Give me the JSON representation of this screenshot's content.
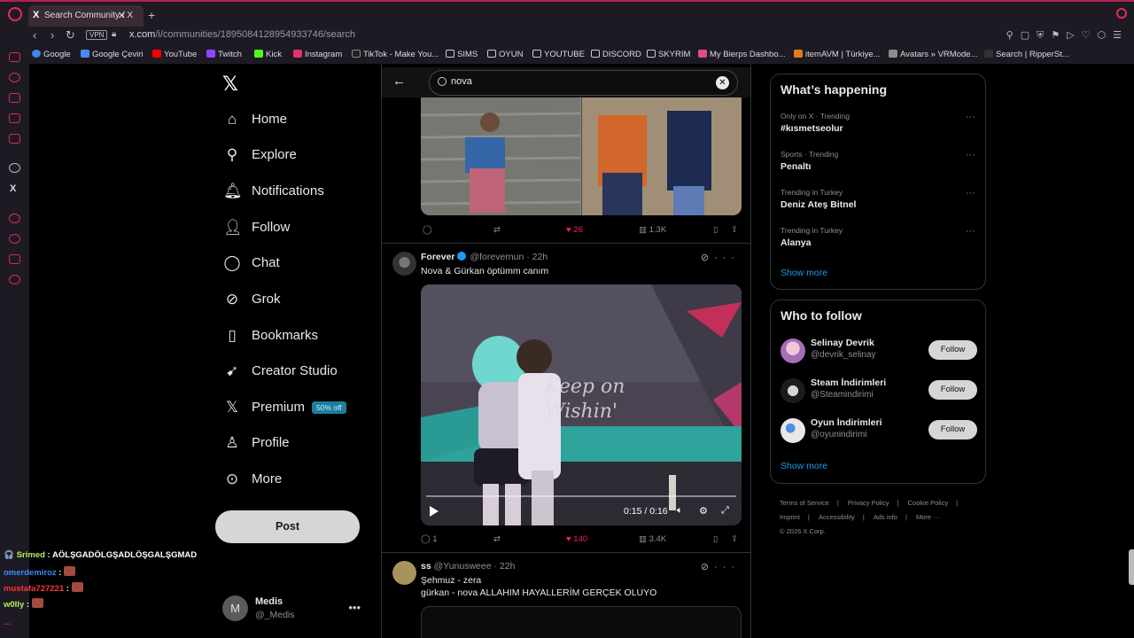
{
  "browser": {
    "tab_title": "Search Community / X",
    "tab_close": "✕",
    "new_tab": "+",
    "vpn_label": "VPN",
    "url_host": "x.com",
    "url_path": "/i/communities/1895084128954933746/search",
    "bookmarks": [
      "Google",
      "Google Çeviri",
      "YouTube",
      "Twitch",
      "Kick",
      "Instagram",
      "TikTok - Make You...",
      "SIMS",
      "OYUN",
      "YOUTUBE",
      "DISCORD",
      "SKYRIM",
      "My Bierps Dashbo...",
      "itemAVM | Türkiye...",
      "Avatars » VRMode...",
      "Search | RipperSt..."
    ]
  },
  "nav": {
    "items": [
      {
        "label": "Home",
        "icon": "home-icon"
      },
      {
        "label": "Explore",
        "icon": "search-icon"
      },
      {
        "label": "Notifications",
        "icon": "bell-icon"
      },
      {
        "label": "Follow",
        "icon": "person-add-icon"
      },
      {
        "label": "Chat",
        "icon": "chat-icon"
      },
      {
        "label": "Grok",
        "icon": "grok-icon"
      },
      {
        "label": "Bookmarks",
        "icon": "bookmark-icon"
      },
      {
        "label": "Creator Studio",
        "icon": "rocket-icon"
      },
      {
        "label": "Premium",
        "icon": "x-icon",
        "badge": "50% off"
      },
      {
        "label": "Profile",
        "icon": "person-icon"
      },
      {
        "label": "More",
        "icon": "more-circle-icon"
      }
    ],
    "post_button": "Post"
  },
  "account": {
    "initial": "M",
    "name": "Medis",
    "handle": "@_Medis",
    "more": "•••"
  },
  "search": {
    "query": "nova",
    "clear": "✕"
  },
  "posts": [
    {
      "replies": "",
      "reposts": "",
      "likes": "26",
      "views": "1.3K"
    },
    {
      "name": "Forever",
      "handle": "@forevernun",
      "time": "22h",
      "text": "Nova & Gürkan öptümm canım",
      "video_overlay": "Keep on\nWishin'",
      "video_time": "0:15 / 0:16",
      "replies": "1",
      "reposts": "",
      "likes": "140",
      "views": "3.4K"
    },
    {
      "name": "ss",
      "handle": "@Yunusweee",
      "time": "22h",
      "text_line1": "Şehmuz - zera",
      "text_line2": "gürkan - nova ALLAHIM HAYALLERİM GERÇEK OLUYO"
    }
  ],
  "sidebar": {
    "happening_title": "What’s happening",
    "trends": [
      {
        "meta": "Only on X · Trending",
        "name": "#kısmetseolur"
      },
      {
        "meta": "Sports · Trending",
        "name": "Penaltı"
      },
      {
        "meta": "Trending in Turkey",
        "name": "Deniz Ateş Bitnel"
      },
      {
        "meta": "Trending in Turkey",
        "name": "Alanya"
      }
    ],
    "show_more": "Show more",
    "follow_title": "Who to follow",
    "who_to_follow": [
      {
        "name": "Selinay Devrik",
        "handle": "@devrik_selinay",
        "button": "Follow"
      },
      {
        "name": "Steam İndirimleri",
        "handle": "@Steamindirimi",
        "button": "Follow"
      },
      {
        "name": "Oyun İndirimleri",
        "handle": "@oyunindirimi",
        "button": "Follow"
      }
    ],
    "footer": [
      "Terms of Service",
      "Privacy Policy",
      "Cookie Policy",
      "Imprint",
      "Accessibility",
      "Ads info",
      "More ···",
      "© 2026 X Corp."
    ]
  },
  "chat": [
    {
      "user": "Srimed",
      "message": "AÖLŞGADÖLGŞADLÖŞGALŞGMAD",
      "color": "#b7f05a"
    },
    {
      "user": "omerdemiroz",
      "message": "",
      "color": "#3b8cff"
    },
    {
      "user": "mustafa727221",
      "message": "",
      "color": "#ff3333"
    },
    {
      "user": "w0lly",
      "message": "",
      "color": "#b7f05a"
    }
  ],
  "chat_ellipsis": "...",
  "colors": {
    "accent": "#1d9bf0",
    "like": "#f91880",
    "opera_red": "#d92d56"
  }
}
